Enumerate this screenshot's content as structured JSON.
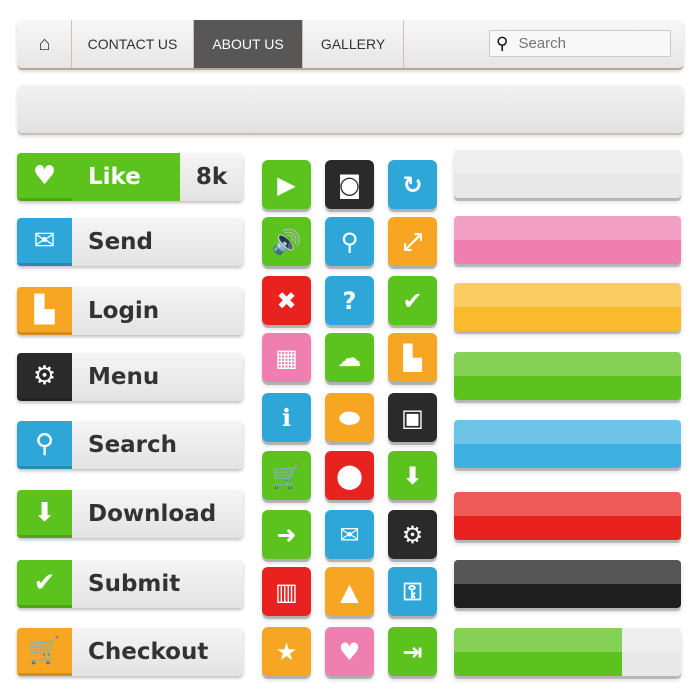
{
  "nav": {
    "home_icon": "home-icon",
    "items": [
      {
        "label": "CONTACT US"
      },
      {
        "label": "ABOUT US",
        "active": true
      },
      {
        "label": "GALLERY"
      }
    ],
    "search_placeholder": "Search",
    "search_icon": "search-icon"
  },
  "buttons": [
    {
      "label": "Like",
      "count": "8k",
      "icon": "heart-icon",
      "color": "#5cc21d"
    },
    {
      "label": "Send",
      "icon": "envelope-icon",
      "color": "#2ea6d8"
    },
    {
      "label": "Login",
      "icon": "user-icon",
      "color": "#f6a623"
    },
    {
      "label": "Menu",
      "icon": "gears-icon",
      "color": "#2a2a2a"
    },
    {
      "label": "Search",
      "icon": "search-icon",
      "color": "#2ea6d8"
    },
    {
      "label": "Download",
      "icon": "download-icon",
      "color": "#5cc21d"
    },
    {
      "label": "Submit",
      "icon": "check-icon",
      "color": "#5cc21d"
    },
    {
      "label": "Checkout",
      "icon": "cart-icon",
      "color": "#f6a623"
    }
  ],
  "icon_grid": [
    {
      "icon": "play-icon",
      "color": "#5cc21d"
    },
    {
      "icon": "camera-icon",
      "color": "#2a2a2a"
    },
    {
      "icon": "refresh-icon",
      "color": "#2ea6d8"
    },
    {
      "icon": "speaker-icon",
      "color": "#5cc21d"
    },
    {
      "icon": "search-icon",
      "color": "#2ea6d8"
    },
    {
      "icon": "expand-icon",
      "color": "#f6a623"
    },
    {
      "icon": "close-icon",
      "color": "#e8231f"
    },
    {
      "icon": "help-icon",
      "color": "#2ea6d8"
    },
    {
      "icon": "check-icon",
      "color": "#5cc21d"
    },
    {
      "icon": "gift-icon",
      "color": "#ee7fb0"
    },
    {
      "icon": "cloud-upload-icon",
      "color": "#5cc21d"
    },
    {
      "icon": "user-icon",
      "color": "#f6a623"
    },
    {
      "icon": "info-icon",
      "color": "#2ea6d8"
    },
    {
      "icon": "tag-icon",
      "color": "#f6a623"
    },
    {
      "icon": "briefcase-icon",
      "color": "#2a2a2a"
    },
    {
      "icon": "cart-icon",
      "color": "#5cc21d"
    },
    {
      "icon": "location-pin-icon",
      "color": "#e8231f"
    },
    {
      "icon": "download-icon",
      "color": "#5cc21d"
    },
    {
      "icon": "login-icon",
      "color": "#5cc21d"
    },
    {
      "icon": "envelope-icon",
      "color": "#2ea6d8"
    },
    {
      "icon": "gears-icon",
      "color": "#2a2a2a"
    },
    {
      "icon": "trash-icon",
      "color": "#e8231f"
    },
    {
      "icon": "lock-icon",
      "color": "#f6a623"
    },
    {
      "icon": "key-icon",
      "color": "#2ea6d8"
    },
    {
      "icon": "star-icon",
      "color": "#f6a623"
    },
    {
      "icon": "heart-icon",
      "color": "#ee7fb0"
    },
    {
      "icon": "exit-icon",
      "color": "#5cc21d"
    }
  ],
  "bars": [
    {
      "color": "#e8e8e8"
    },
    {
      "color": "#ee7fb0"
    },
    {
      "color": "#f9bb2c"
    },
    {
      "color": "#5cc21d"
    },
    {
      "color": "#3eb0e0"
    },
    {
      "color": "#e8231f"
    },
    {
      "color": "#1e1e1e"
    },
    {
      "color": "#5cc21d"
    }
  ]
}
